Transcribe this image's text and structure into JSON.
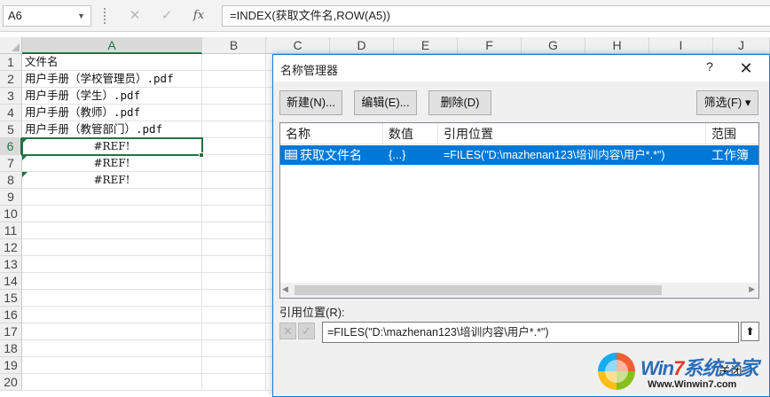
{
  "formula_bar": {
    "name_box": "A6",
    "fx_label": "fx",
    "formula": "=INDEX(获取文件名,ROW(A5))"
  },
  "sheet": {
    "columns": [
      "A",
      "B",
      "C",
      "D",
      "E",
      "F",
      "G",
      "H",
      "I",
      "J"
    ],
    "rows": [
      "1",
      "2",
      "3",
      "4",
      "5",
      "6",
      "7",
      "8",
      "9",
      "10",
      "11",
      "12",
      "13",
      "14",
      "15",
      "16",
      "17",
      "18",
      "19",
      "20"
    ],
    "cells_a": [
      "文件名",
      "用户手册（学校管理员）.pdf",
      "用户手册（学生）.pdf",
      "用户手册（教师）.pdf",
      "用户手册（教管部门）.pdf",
      "#REF!",
      "#REF!",
      "#REF!"
    ],
    "selected_cell": "A6"
  },
  "dialog": {
    "title": "名称管理器",
    "help": "?",
    "close": "✕",
    "buttons": {
      "new": "新建(N)...",
      "edit": "编辑(E)...",
      "delete": "删除(D)",
      "filter": "筛选(F) ▾"
    },
    "list_headers": [
      "名称",
      "数值",
      "引用位置",
      "范围"
    ],
    "list_rows": [
      {
        "name": "获取文件名",
        "value": "{...}",
        "refers_to": "=FILES(\"D:\\mazhenan123\\培训内容\\用户*.*\")",
        "scope": "工作簿"
      }
    ],
    "ref_label": "引用位置(R):",
    "ref_value": "=FILES(\"D:\\mazhenan123\\培训内容\\用户*.*\")",
    "close_button": "关闭"
  },
  "watermark": {
    "brand_prefix": "Win",
    "brand_seven": "7",
    "brand_suffix": "系统之家",
    "url": "Www.Winwin7.com"
  }
}
